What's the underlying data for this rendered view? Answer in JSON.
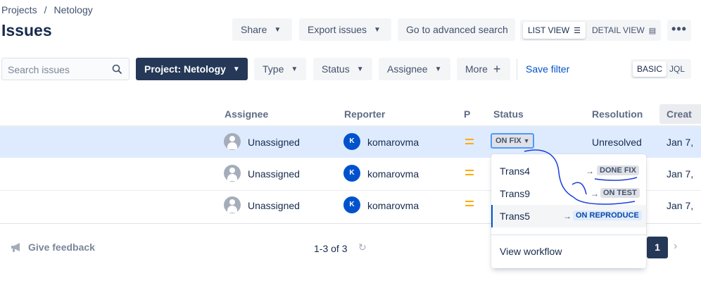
{
  "breadcrumb": {
    "items": [
      "Projects",
      "Netology"
    ],
    "separator": "/"
  },
  "page_title": "Issues",
  "toolbar": {
    "share": "Share",
    "export": "Export issues",
    "advanced": "Go to advanced search",
    "list_view": "LIST VIEW",
    "detail_view": "DETAIL VIEW",
    "more_actions": "•••"
  },
  "filters": {
    "search_placeholder": "Search issues",
    "project": "Project: Netology",
    "type": "Type",
    "status": "Status",
    "assignee": "Assignee",
    "more": "More",
    "save_filter": "Save filter",
    "basic": "BASIC",
    "jql": "JQL"
  },
  "table": {
    "headers": {
      "assignee": "Assignee",
      "reporter": "Reporter",
      "priority": "P",
      "status": "Status",
      "resolution": "Resolution",
      "created": "Creat"
    },
    "rows": [
      {
        "assignee": "Unassigned",
        "reporter_initial": "K",
        "reporter": "komarovma",
        "status": "ON FIX",
        "resolution": "Unresolved",
        "created": "Jan 7,"
      },
      {
        "assignee": "Unassigned",
        "reporter_initial": "K",
        "reporter": "komarovma",
        "created": "Jan 7,"
      },
      {
        "assignee": "Unassigned",
        "reporter_initial": "K",
        "reporter": "komarovma",
        "created": "Jan 7,"
      }
    ]
  },
  "transitions": {
    "items": [
      {
        "name": "Trans4",
        "target": "DONE FIX"
      },
      {
        "name": "Trans9",
        "target": "ON TEST"
      },
      {
        "name": "Trans5",
        "target": "ON REPRODUCE"
      }
    ],
    "view_workflow": "View workflow"
  },
  "footer": {
    "feedback": "Give feedback",
    "count": "1-3 of 3",
    "page": "1"
  },
  "colors": {
    "accent": "#0052CC",
    "dark_button": "#253858",
    "selected_row": "#DEEBFF",
    "priority_medium": "#FFAB00",
    "annotation_ink": "#1A3FD9"
  }
}
